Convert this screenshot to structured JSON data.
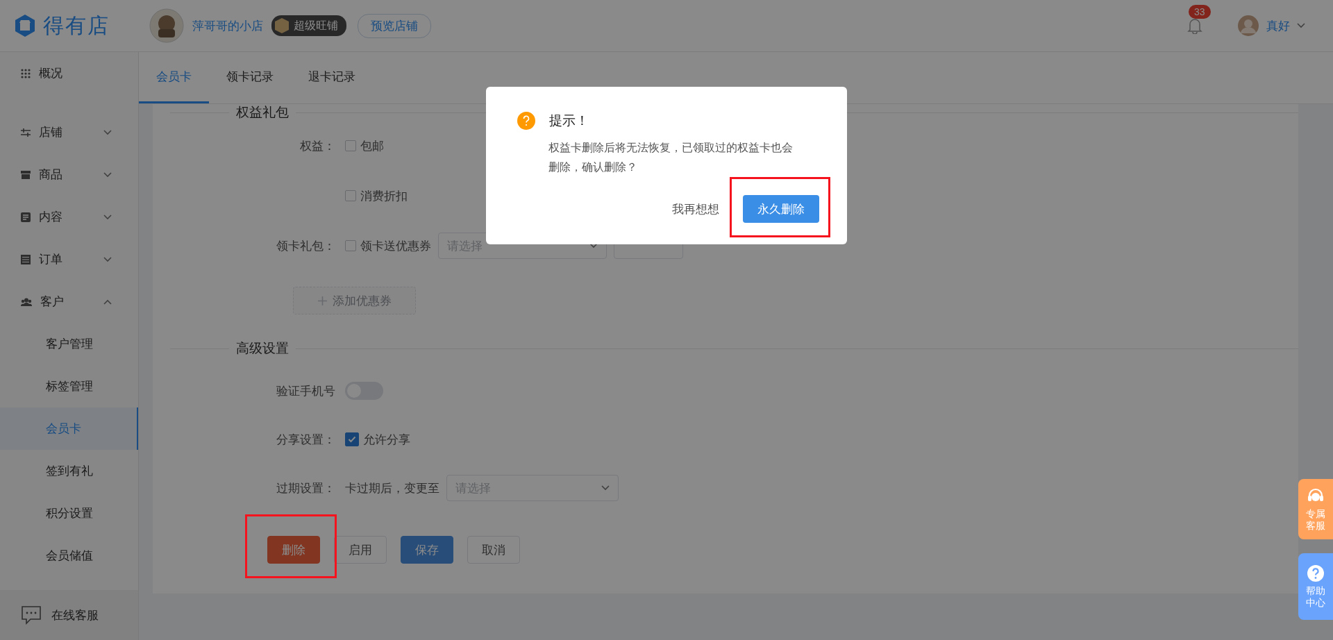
{
  "header": {
    "logo": "得有店",
    "shop_name": "萍哥哥的小店",
    "shop_level": "超级旺铺",
    "preview_button": "预览店铺",
    "notifications": "33",
    "user_name": "真好"
  },
  "sidebar": {
    "items": [
      {
        "label": "概况",
        "kind": "link"
      },
      {
        "label": "店铺",
        "kind": "group",
        "expanded": false
      },
      {
        "label": "商品",
        "kind": "group",
        "expanded": false
      },
      {
        "label": "内容",
        "kind": "group",
        "expanded": false
      },
      {
        "label": "订单",
        "kind": "group",
        "expanded": false
      },
      {
        "label": "客户",
        "kind": "group",
        "expanded": true,
        "children": [
          {
            "label": "客户管理",
            "selected": false
          },
          {
            "label": "标签管理",
            "selected": false
          },
          {
            "label": "会员卡",
            "selected": true
          },
          {
            "label": "签到有礼",
            "selected": false
          },
          {
            "label": "积分设置",
            "selected": false
          },
          {
            "label": "会员储值",
            "selected": false
          }
        ]
      }
    ],
    "footer": "在线客服"
  },
  "tabs": [
    {
      "label": "会员卡",
      "selected": true
    },
    {
      "label": "领卡记录",
      "selected": false
    },
    {
      "label": "退卡记录",
      "selected": false
    }
  ],
  "form": {
    "sections": [
      {
        "title": "权益礼包",
        "rows": [
          {
            "kind": "checkbox",
            "label": "权益：",
            "options": [
              {
                "label": "包邮",
                "checked": false
              }
            ]
          },
          {
            "kind": "checkbox",
            "options": [
              {
                "label": "消费折扣",
                "checked": false
              }
            ]
          },
          {
            "kind": "coupon",
            "label": "领卡礼包：",
            "checkbox": {
              "label": "领卡送优惠券",
              "checked": false
            },
            "placeholder": "请选择"
          },
          {
            "kind": "add",
            "button": "添加优惠券",
            "disabled": true
          }
        ]
      },
      {
        "title": "高级设置",
        "rows": [
          {
            "kind": "toggle",
            "label": "验证手机号",
            "on": false
          },
          {
            "kind": "checkbox",
            "label": "分享设置：",
            "options": [
              {
                "label": "允许分享",
                "checked": true
              }
            ]
          },
          {
            "kind": "select",
            "label": "过期设置：",
            "prefix": "卡过期后，变更至",
            "placeholder": "请选择"
          }
        ]
      }
    ],
    "actions": [
      {
        "label": "删除",
        "kind": "danger",
        "highlighted": true
      },
      {
        "label": "启用",
        "kind": "default",
        "highlighted": false
      },
      {
        "label": "保存",
        "kind": "primary",
        "highlighted": false
      },
      {
        "label": "取消",
        "kind": "default",
        "highlighted": false
      }
    ]
  },
  "dialog": {
    "title": "提示！",
    "message": "权益卡删除后将无法恢复，已领取过的权益卡也会删除，确认删除？",
    "buttons": [
      {
        "label": "我再想想",
        "kind": "text",
        "highlighted": false
      },
      {
        "label": "永久删除",
        "kind": "primary",
        "highlighted": true
      }
    ]
  },
  "side_widgets": [
    {
      "label": "专属客服",
      "kind": "service"
    },
    {
      "label": "帮助中心",
      "kind": "help"
    }
  ]
}
